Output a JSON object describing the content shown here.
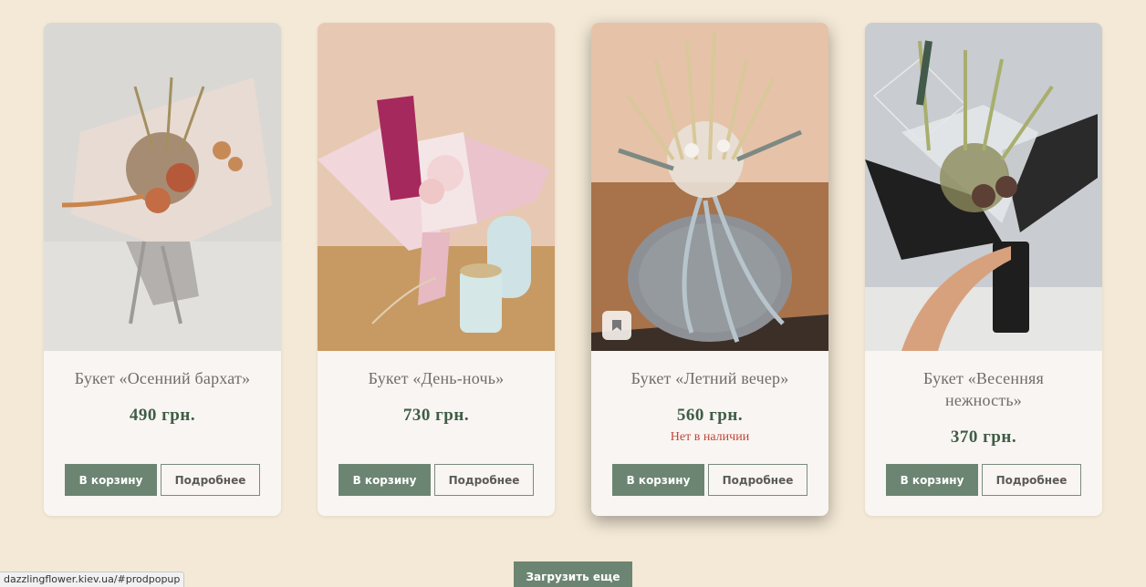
{
  "products": [
    {
      "name": "Букет «Осенний бархат»",
      "price": "490 грн.",
      "stock": "",
      "cart_label": "В корзину",
      "details_label": "Подробнее",
      "image_icon": "autumn-bouquet-image"
    },
    {
      "name": "Букет «День-ночь»",
      "price": "730 грн.",
      "stock": "",
      "cart_label": "В корзину",
      "details_label": "Подробнее",
      "image_icon": "day-night-bouquet-image"
    },
    {
      "name": "Букет «Летний вечер»",
      "price": "560 грн.",
      "stock": "Нет в наличии",
      "cart_label": "В корзину",
      "details_label": "Подробнее",
      "image_icon": "summer-evening-bouquet-image",
      "bookmark_icon": "bookmark-icon"
    },
    {
      "name": "Букет «Весенняя нежность»",
      "price": "370 грн.",
      "stock": "",
      "cart_label": "В корзину",
      "details_label": "Подробнее",
      "image_icon": "spring-tenderness-bouquet-image"
    }
  ],
  "load_more_label": "Загрузить еще",
  "status_url": "dazzlingflower.kiev.ua/#prodpopup",
  "colors": {
    "page_background": "#f4e9d6",
    "card_background": "#f9f5f2",
    "accent_green": "#6c8572",
    "price_green": "#3e5d46",
    "out_of_stock_red": "#c0473a",
    "title_gray": "#6e6d68"
  }
}
